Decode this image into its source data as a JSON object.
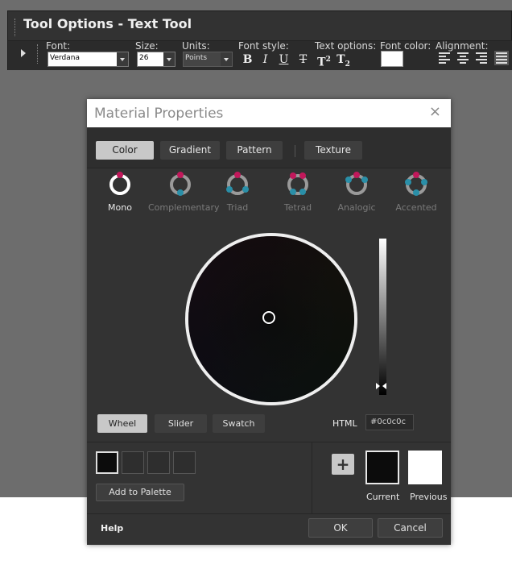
{
  "tool_options": {
    "title": "Tool Options - Text Tool",
    "font_label": "Font:",
    "font_value": "Verdana",
    "size_label": "Size:",
    "size_value": "26",
    "units_label": "Units:",
    "units_value": "Points",
    "font_style_label": "Font style:",
    "text_options_label": "Text options:",
    "font_color_label": "Font color:",
    "alignment_label": "Alignment:",
    "bold": "B",
    "italic": "I",
    "underline": "U",
    "strike": "T",
    "superscript": "T",
    "superscript_mark": "2",
    "subscript": "T",
    "subscript_mark": "2",
    "font_color": "#ffffff"
  },
  "dialog": {
    "title": "Material Properties",
    "close": "×",
    "tabs": [
      {
        "label": "Color",
        "active": true
      },
      {
        "label": "Gradient"
      },
      {
        "label": "Pattern"
      },
      {
        "label": "Texture"
      }
    ],
    "harmonies": [
      {
        "label": "Mono",
        "active": true,
        "icon": "mono-harmony-icon"
      },
      {
        "label": "Complementary",
        "icon": "complementary-harmony-icon"
      },
      {
        "label": "Triad",
        "icon": "triad-harmony-icon"
      },
      {
        "label": "Tetrad",
        "icon": "tetrad-harmony-icon"
      },
      {
        "label": "Analogic",
        "icon": "analogic-harmony-icon"
      },
      {
        "label": "Accented",
        "icon": "accented-harmony-icon"
      }
    ],
    "modes": [
      {
        "label": "Wheel",
        "active": true
      },
      {
        "label": "Slider"
      },
      {
        "label": "Swatch"
      }
    ],
    "html_label": "HTML",
    "html_value": "#0c0c0c",
    "add_to_palette": "Add to Palette",
    "add_button": "+",
    "current_label": "Current",
    "previous_label": "Previous",
    "current_color": "#0c0c0c",
    "previous_color": "#ffffff",
    "help": "Help",
    "ok": "OK",
    "cancel": "Cancel"
  },
  "colors": {
    "accent_magenta": "#c2185b",
    "accent_teal": "#2a8fa8"
  }
}
